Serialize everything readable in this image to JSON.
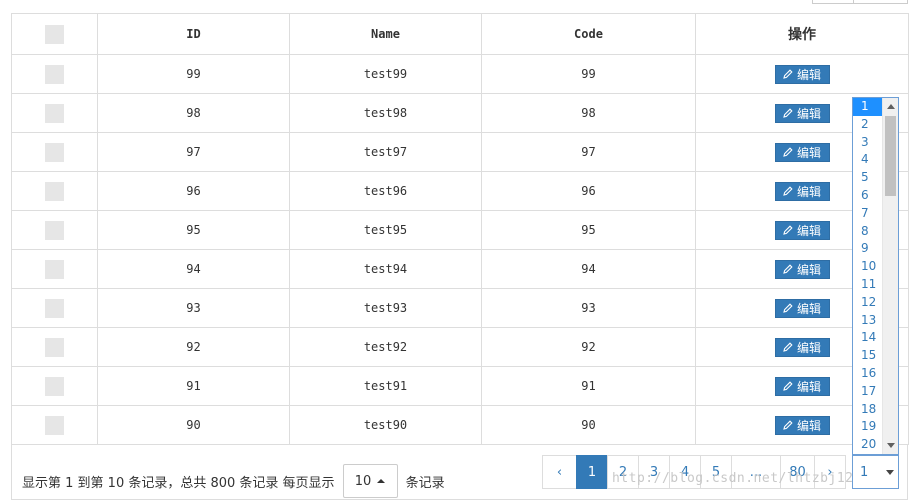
{
  "table": {
    "headers": {
      "id": "ID",
      "name": "Name",
      "code": "Code",
      "ops": "操作"
    },
    "rows": [
      {
        "id": "99",
        "name": "test99",
        "code": "99",
        "edit": "编辑"
      },
      {
        "id": "98",
        "name": "test98",
        "code": "98",
        "edit": "编辑"
      },
      {
        "id": "97",
        "name": "test97",
        "code": "97",
        "edit": "编辑"
      },
      {
        "id": "96",
        "name": "test96",
        "code": "96",
        "edit": "编辑"
      },
      {
        "id": "95",
        "name": "test95",
        "code": "95",
        "edit": "编辑"
      },
      {
        "id": "94",
        "name": "test94",
        "code": "94",
        "edit": "编辑"
      },
      {
        "id": "93",
        "name": "test93",
        "code": "93",
        "edit": "编辑"
      },
      {
        "id": "92",
        "name": "test92",
        "code": "92",
        "edit": "编辑"
      },
      {
        "id": "91",
        "name": "test91",
        "code": "91",
        "edit": "编辑"
      },
      {
        "id": "90",
        "name": "test90",
        "code": "90",
        "edit": "编辑"
      }
    ],
    "edit_icon": "pencil-icon"
  },
  "footer": {
    "summary_prefix": "显示第 1 到第 10 条记录，总共 800 条记录 每页显示",
    "page_size": "10",
    "summary_suffix": "条记录"
  },
  "pagination": {
    "prev": "‹",
    "pages": [
      "1",
      "2",
      "3",
      "4",
      "5"
    ],
    "active": "1",
    "ellipsis": "...",
    "last": "80",
    "next": "›"
  },
  "jump": {
    "selected": "1",
    "options": [
      "1",
      "2",
      "3",
      "4",
      "5",
      "6",
      "7",
      "8",
      "9",
      "10",
      "11",
      "12",
      "13",
      "14",
      "15",
      "16",
      "17",
      "18",
      "19",
      "20"
    ]
  },
  "watermark": "http://blog.csdn.net/lhtzbj12",
  "colors": {
    "primary": "#337ab7",
    "border": "#dddddd",
    "selected_option": "#1e90ff"
  }
}
